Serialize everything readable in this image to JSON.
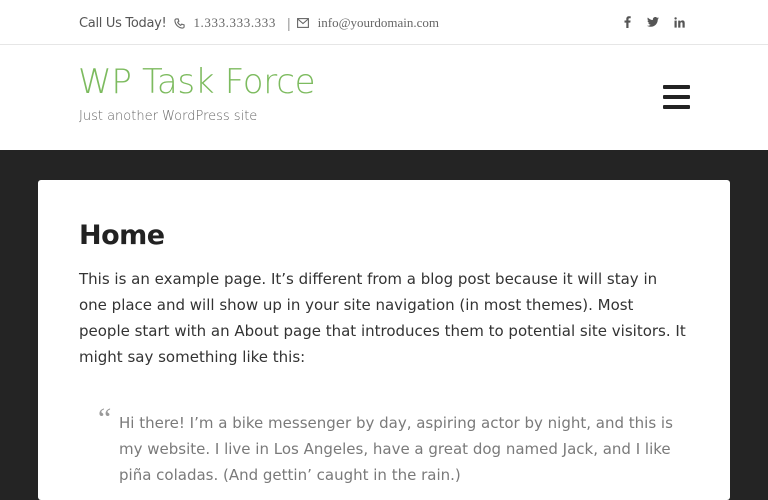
{
  "topbar": {
    "cta": "Call Us Today!",
    "phone": "1.333.333.333",
    "separator": "|",
    "email": "info@yourdomain.com",
    "social": [
      "facebook-icon",
      "twitter-icon",
      "linkedin-icon"
    ]
  },
  "header": {
    "site_title": "WP Task Force",
    "tagline": "Just another WordPress site",
    "menu_icon": "hamburger-menu-icon"
  },
  "content": {
    "title": "Home",
    "intro": "This is an example page. It’s different from a blog post because it will stay in one place and will show up in your site navigation (in most themes). Most people start with an About page that introduces them to potential site visitors. It might say something like this:",
    "quote_mark": "“",
    "quote": "Hi there! I’m a bike messenger by day, aspiring actor by night, and this is my website. I live in Los Angeles, have a great dog named Jack, and I like piña coladas. (And gettin’ caught in the rain.)"
  },
  "colors": {
    "accent": "#7dbb5f",
    "dark_background": "#242424",
    "text": "#333333",
    "quote_text": "#7a7a7a"
  }
}
